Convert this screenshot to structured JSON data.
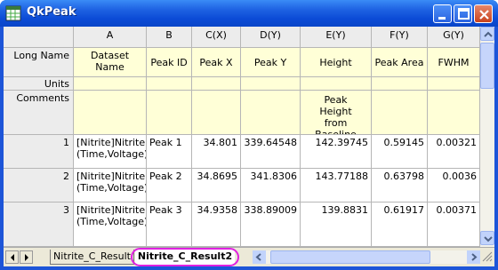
{
  "window": {
    "title": "QkPeak"
  },
  "columns": [
    {
      "letter": "A",
      "long_name": "Dataset Name",
      "units": "",
      "comments": ""
    },
    {
      "letter": "B",
      "long_name": "Peak ID",
      "units": "",
      "comments": ""
    },
    {
      "letter": "C(X)",
      "long_name": "Peak X",
      "units": "",
      "comments": ""
    },
    {
      "letter": "D(Y)",
      "long_name": "Peak Y",
      "units": "",
      "comments": ""
    },
    {
      "letter": "E(Y)",
      "long_name": "Height",
      "units": "",
      "comments": "Peak Height from Baseline"
    },
    {
      "letter": "F(Y)",
      "long_name": "Peak Area",
      "units": "",
      "comments": ""
    },
    {
      "letter": "G(Y)",
      "long_name": "FWHM",
      "units": "",
      "comments": ""
    }
  ],
  "row_labels": {
    "long_name": "Long Name",
    "units": "Units",
    "comments": "Comments"
  },
  "rows": [
    {
      "index": "1",
      "cells": [
        "[Nitrite]Nitrite!(Time,Voltage)",
        "Peak 1",
        "34.801",
        "339.64548",
        "142.39745",
        "0.59145",
        "0.00321"
      ]
    },
    {
      "index": "2",
      "cells": [
        "[Nitrite]Nitrite!(Time,Voltage)",
        "Peak 2",
        "34.8695",
        "341.8306",
        "143.77188",
        "0.63798",
        "0.0036"
      ]
    },
    {
      "index": "3",
      "cells": [
        "[Nitrite]Nitrite!(Time,Voltage)",
        "Peak 3",
        "34.9358",
        "338.89009",
        "139.8831",
        "0.61917",
        "0.00371"
      ]
    }
  ],
  "sheets": [
    {
      "name": "Nitrite_C_Result",
      "active": false
    },
    {
      "name": "Nitrite_C_Result2",
      "active": true
    }
  ],
  "colors": {
    "titlebar": "#0a46c8",
    "meta_rows": "#ffffd7",
    "highlight_ring": "#e020e0"
  }
}
